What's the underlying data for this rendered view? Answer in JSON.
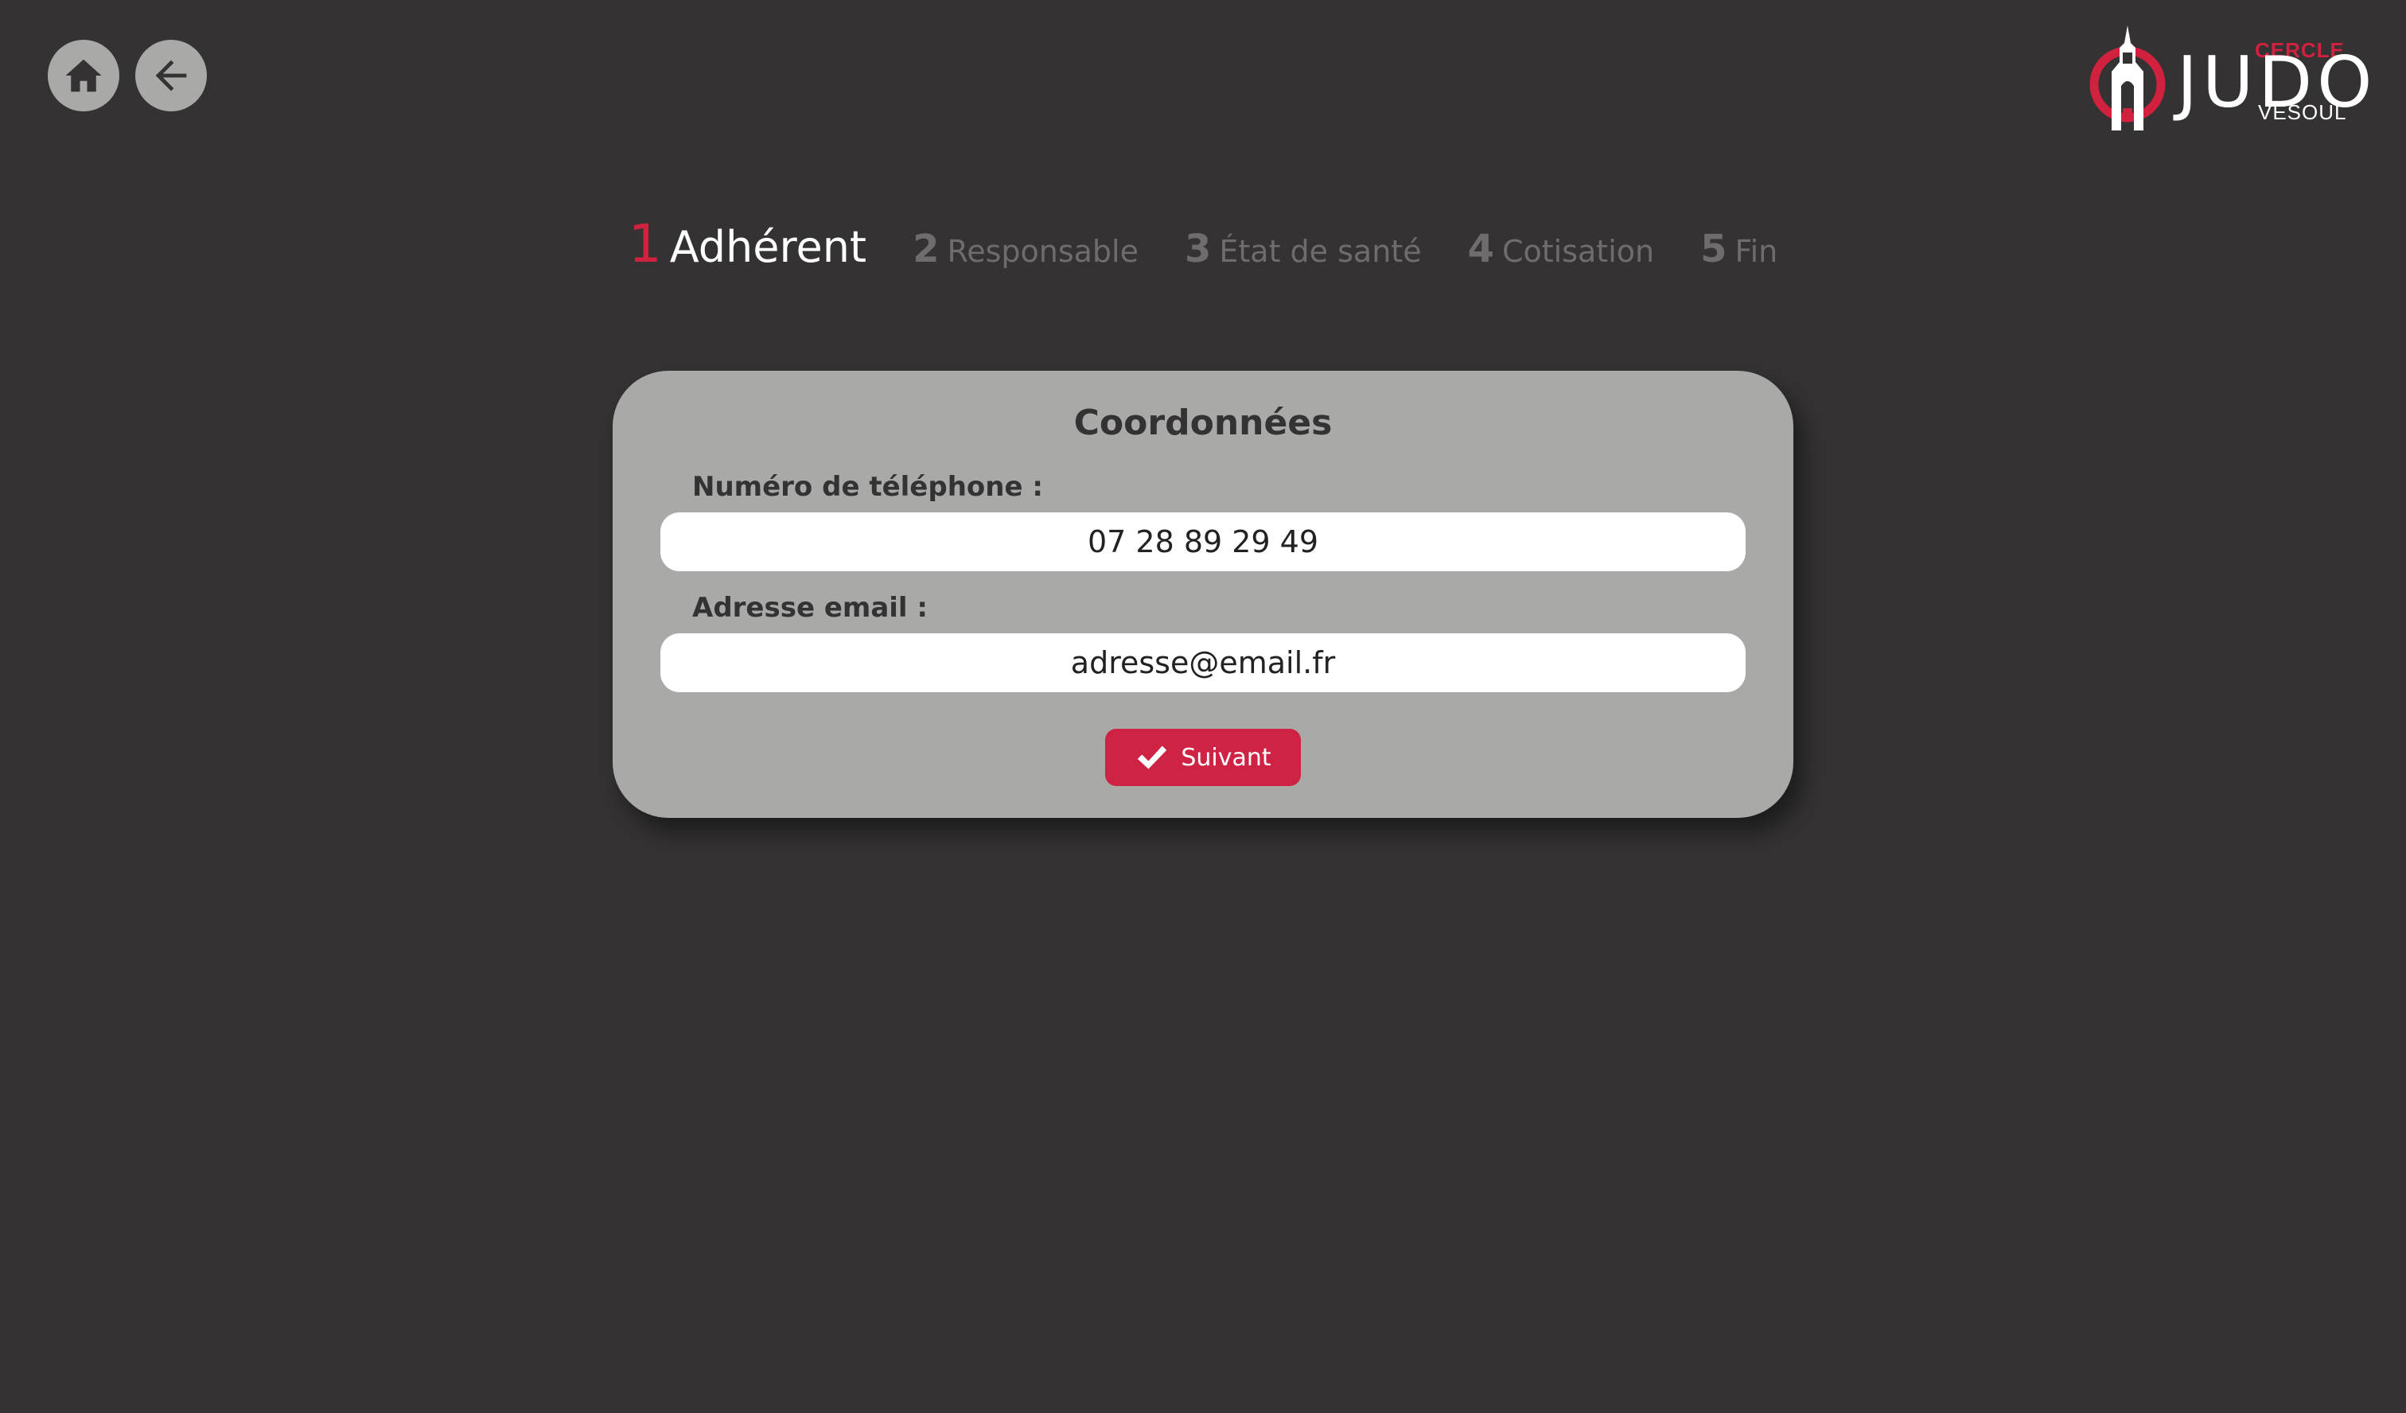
{
  "nav": {
    "home_icon": "home-icon",
    "back_icon": "arrow-left-icon"
  },
  "logo": {
    "cercle": "CERCLE",
    "judo": "JUDO",
    "vesoul": "VESOUL"
  },
  "steps": [
    {
      "num": "1",
      "label": "Adhérent",
      "active": true
    },
    {
      "num": "2",
      "label": "Responsable",
      "active": false
    },
    {
      "num": "3",
      "label": "État de santé",
      "active": false
    },
    {
      "num": "4",
      "label": "Cotisation",
      "active": false
    },
    {
      "num": "5",
      "label": "Fin",
      "active": false
    }
  ],
  "form": {
    "title": "Coordonnées",
    "phone_label": "Numéro de téléphone :",
    "phone_value": "07 28 89 29 49",
    "email_label": "Adresse email :",
    "email_value": "adresse@email.fr",
    "submit_label": "Suivant",
    "submit_icon": "check-icon"
  },
  "colors": {
    "background": "#343233",
    "card": "#a9a9a8",
    "accent": "#cf2345",
    "inactive_step": "#6e6c6d"
  }
}
